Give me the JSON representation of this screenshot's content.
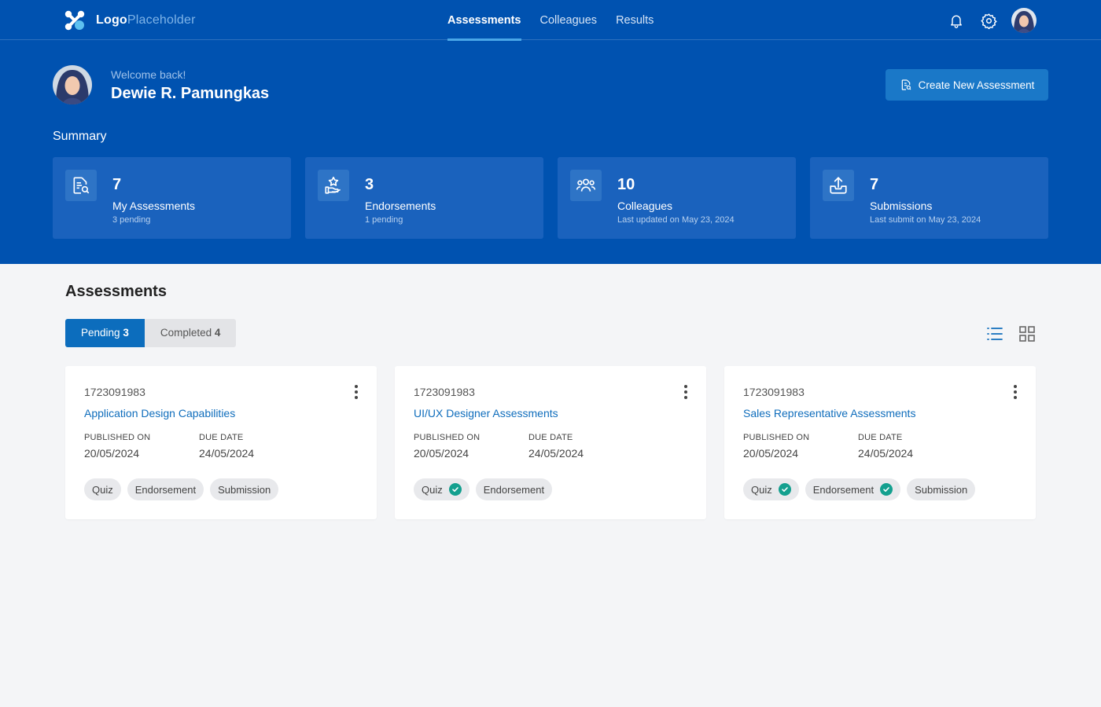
{
  "brand": {
    "logo_bold": "Logo",
    "logo_light": "Placeholder"
  },
  "nav": {
    "items": [
      {
        "label": "Assessments",
        "active": true
      },
      {
        "label": "Colleagues",
        "active": false
      },
      {
        "label": "Results",
        "active": false
      }
    ]
  },
  "header_icons": [
    "bell-icon",
    "gear-icon",
    "user-avatar"
  ],
  "user": {
    "greeting": "Welcome back!",
    "name": "Dewie R. Pamungkas"
  },
  "actions": {
    "create_label": "Create New Assessment"
  },
  "summary": {
    "title": "Summary",
    "cards": [
      {
        "icon": "assessment-search-icon",
        "value": "7",
        "label": "My Assessments",
        "sub": "3 pending"
      },
      {
        "icon": "endorsement-hand-star-icon",
        "value": "3",
        "label": "Endorsements",
        "sub": "1 pending"
      },
      {
        "icon": "people-group-icon",
        "value": "10",
        "label": "Colleagues",
        "sub": "Last updated on May 23, 2024"
      },
      {
        "icon": "upload-tray-icon",
        "value": "7",
        "label": "Submissions",
        "sub": "Last submit on May 23, 2024"
      }
    ]
  },
  "assessments": {
    "title": "Assessments",
    "tabs": [
      {
        "label": "Pending",
        "count": "3",
        "active": true
      },
      {
        "label": "Completed",
        "count": "4",
        "active": false
      }
    ],
    "view_modes": [
      "list-view-icon",
      "grid-view-icon"
    ],
    "published_label": "PUBLISHED ON",
    "due_label": "DUE DATE",
    "cards": [
      {
        "id": "1723091983",
        "title": "Application Design Capabilities",
        "published": "20/05/2024",
        "due": "24/05/2024",
        "tags": [
          {
            "label": "Quiz",
            "done": false
          },
          {
            "label": "Endorsement",
            "done": false
          },
          {
            "label": "Submission",
            "done": false
          }
        ]
      },
      {
        "id": "1723091983",
        "title": "UI/UX Designer Assessments",
        "published": "20/05/2024",
        "due": "24/05/2024",
        "tags": [
          {
            "label": "Quiz",
            "done": true
          },
          {
            "label": "Endorsement",
            "done": false
          }
        ]
      },
      {
        "id": "1723091983",
        "title": "Sales Representative Assessments",
        "published": "20/05/2024",
        "due": "24/05/2024",
        "tags": [
          {
            "label": "Quiz",
            "done": true
          },
          {
            "label": "Endorsement",
            "done": true
          },
          {
            "label": "Submission",
            "done": false
          }
        ]
      }
    ]
  },
  "colors": {
    "hero": "#0052b0",
    "primary_button": "#1a78c8",
    "stat_card": "#1a62bd",
    "link": "#0f6dbc",
    "check": "#14a08f",
    "page_bg": "#f4f5f7"
  }
}
